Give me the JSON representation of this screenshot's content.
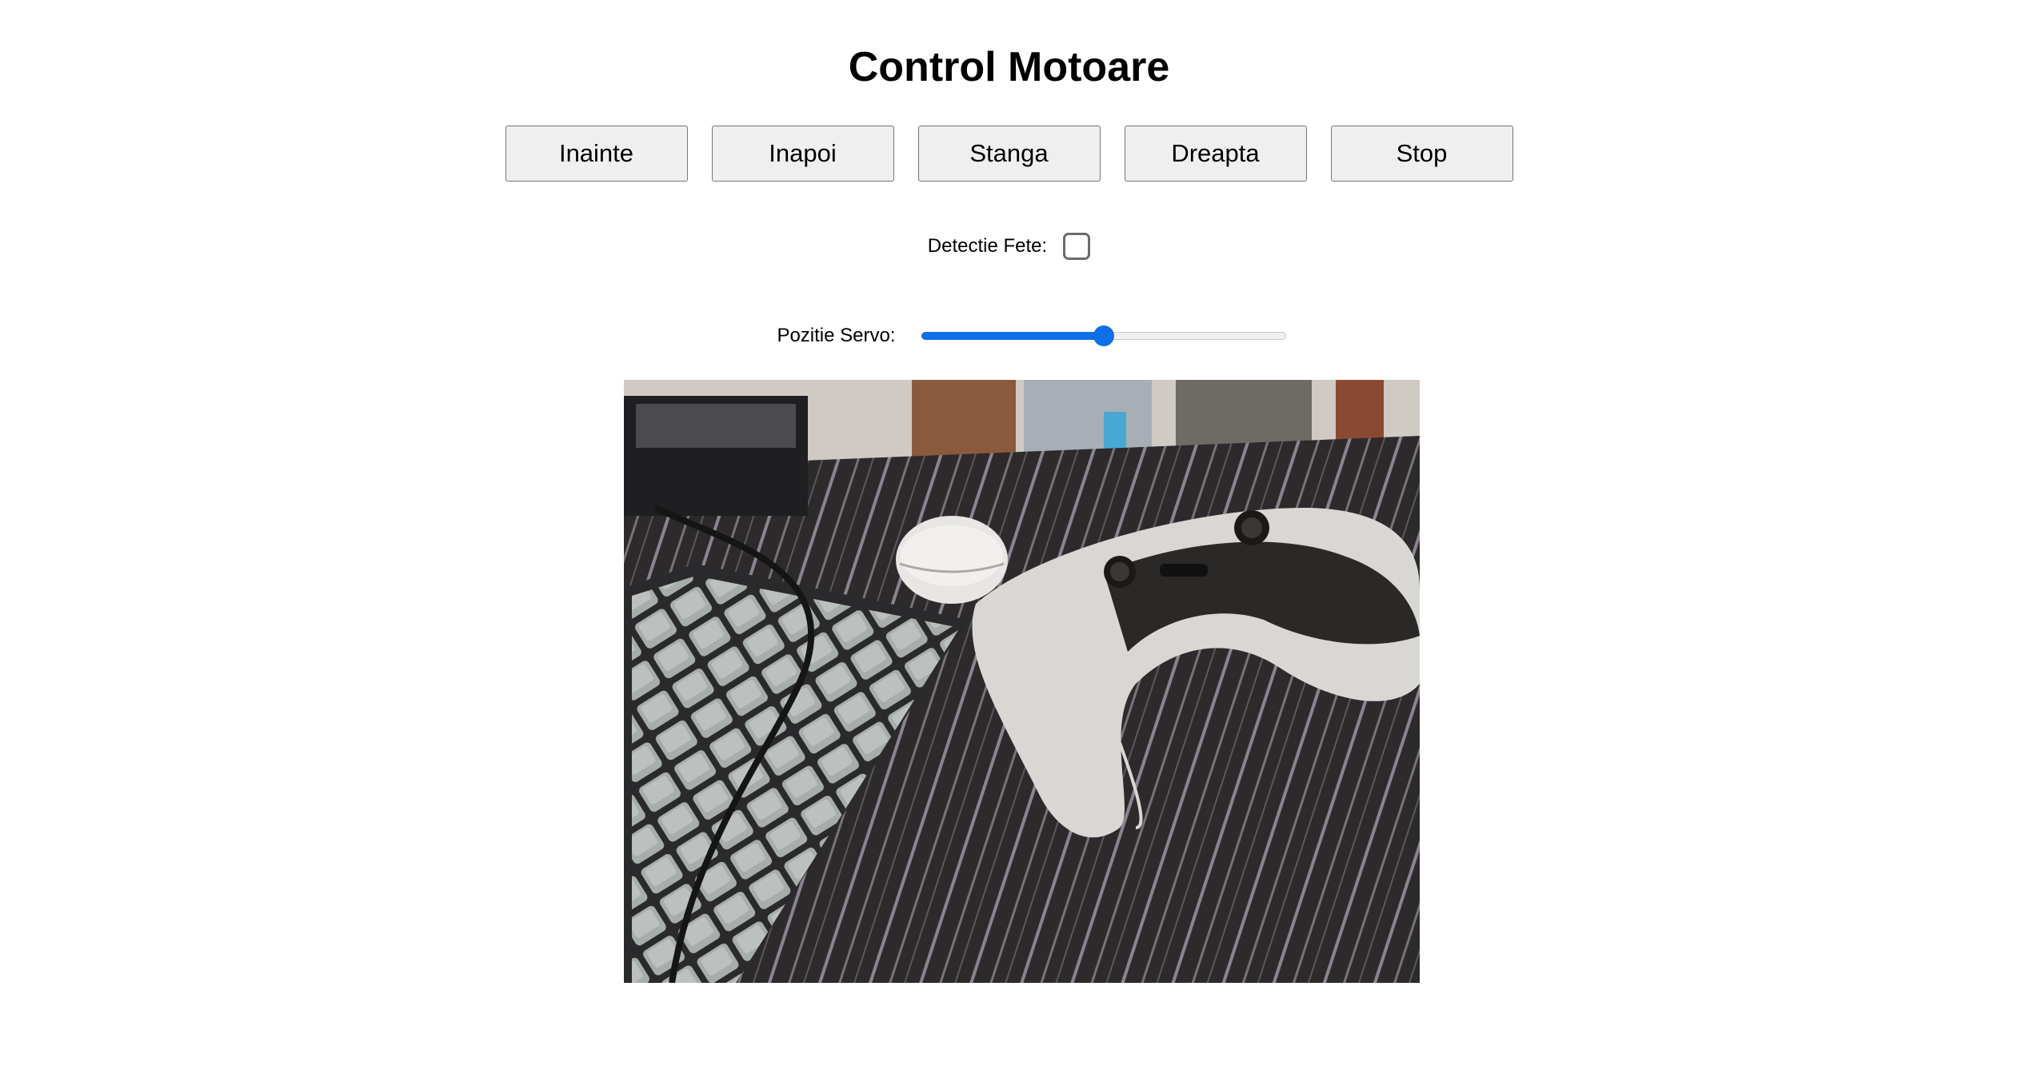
{
  "header": {
    "title": "Control Motoare"
  },
  "controls": {
    "forward_label": "Inainte",
    "back_label": "Inapoi",
    "left_label": "Stanga",
    "right_label": "Dreapta",
    "stop_label": "Stop"
  },
  "face_detection": {
    "label": "Detectie Fete:",
    "checked": false
  },
  "servo": {
    "label": "Pozitie Servo:",
    "value_fraction": 0.5
  },
  "camera": {
    "scene": "desk with keyboard, wireless earbuds case and game controller"
  },
  "colors": {
    "accent": "#0f6fe6",
    "button_bg": "#efefef",
    "button_border": "#767676"
  }
}
